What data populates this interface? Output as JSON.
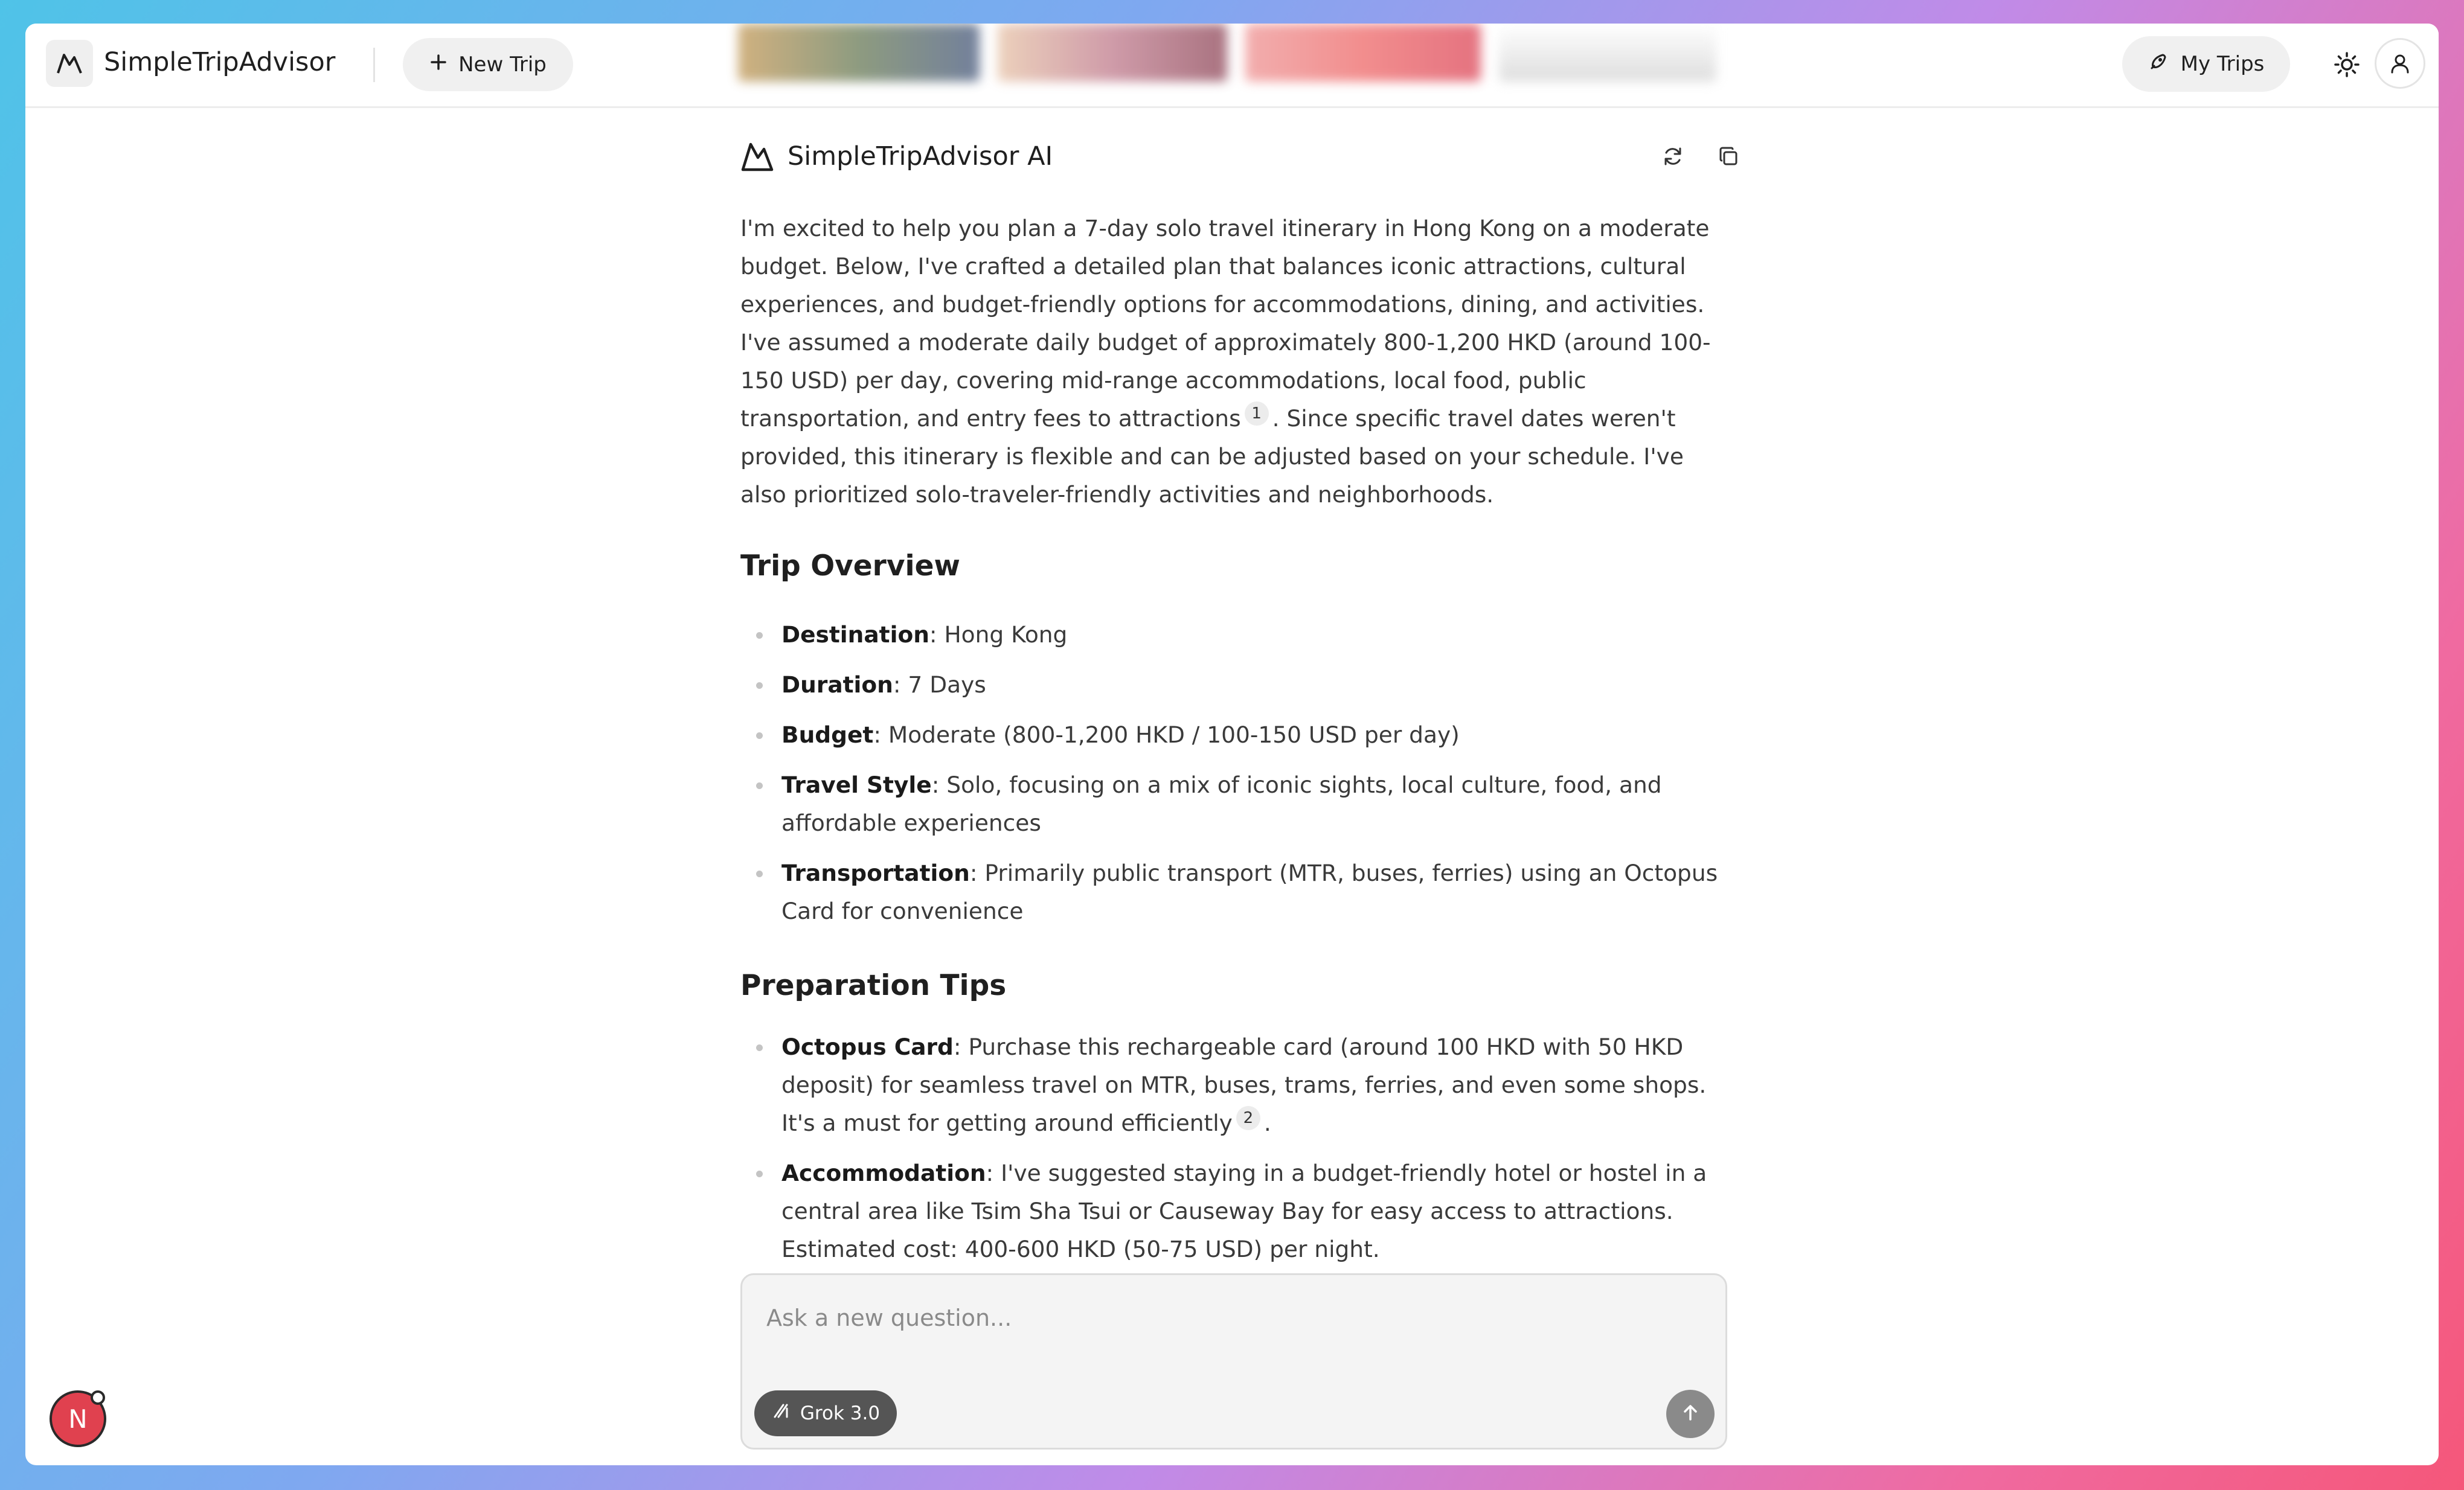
{
  "app": {
    "brand": "SimpleTripAdvisor",
    "new_trip_label": "New Trip",
    "my_trips_label": "My Trips"
  },
  "response": {
    "assistant_name": "SimpleTripAdvisor AI",
    "intro_part1": "I'm excited to help you plan a 7-day solo travel itinerary in Hong Kong on a moderate budget. Below, I've crafted a detailed plan that balances iconic attractions, cultural experiences, and budget-friendly options for accommodations, dining, and activities. I've assumed a moderate daily budget of approximately 800-1,200 HKD (around 100-150 USD) per day, covering mid-range accommodations, local food, public transportation, and entry fees to attractions",
    "intro_cite": "1",
    "intro_part2": ". Since specific travel dates weren't provided, this itinerary is flexible and can be adjusted based on your schedule. I've also prioritized solo-traveler-friendly activities and neighborhoods.",
    "overview": {
      "heading": "Trip Overview",
      "items": [
        {
          "label": "Destination",
          "text": ": Hong Kong"
        },
        {
          "label": "Duration",
          "text": ": 7 Days"
        },
        {
          "label": "Budget",
          "text": ": Moderate (800-1,200 HKD / 100-150 USD per day)"
        },
        {
          "label": "Travel Style",
          "text": ": Solo, focusing on a mix of iconic sights, local culture, food, and affordable experiences"
        },
        {
          "label": "Transportation",
          "text": ": Primarily public transport (MTR, buses, ferries) using an Octopus Card for convenience"
        }
      ]
    },
    "prep": {
      "heading": "Preparation Tips",
      "items": [
        {
          "label": "Octopus Card",
          "text": ": Purchase this rechargeable card (around 100 HKD with 50 HKD deposit) for seamless travel on MTR, buses, trams, ferries, and even some shops. It's a must for getting around efficiently",
          "cite": "2",
          "tail": "."
        },
        {
          "label": "Accommodation",
          "text": ": I've suggested staying in a budget-friendly hotel or hostel in a central area like Tsim Sha Tsui or Causeway Bay for easy access to attractions. Estimated cost: 400-600 HKD (50-75 USD) per night."
        }
      ]
    }
  },
  "composer": {
    "placeholder": "Ask a new question...",
    "model_label": "Grok 3.0"
  },
  "avatar_badge": "N",
  "colors": {
    "accent_dark": "#555555",
    "send_button": "#8a8a8a",
    "badge_red": "#e0414f"
  },
  "icons": [
    "logo-mountain-icon",
    "plus-icon",
    "rocket-icon",
    "sun-icon",
    "user-icon",
    "refresh-icon",
    "copy-icon",
    "grok-icon",
    "arrow-up-icon"
  ]
}
